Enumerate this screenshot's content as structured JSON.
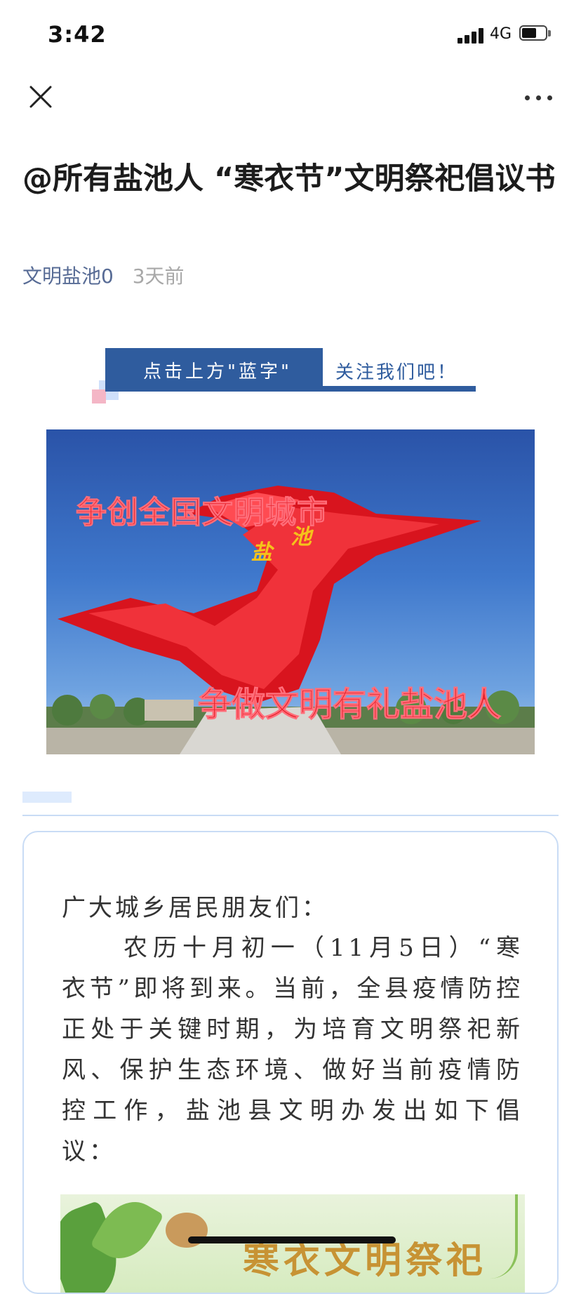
{
  "status_bar": {
    "time": "3:42",
    "network": "4G"
  },
  "nav": {
    "close_icon": "close-icon",
    "more_icon": "more-dots-icon"
  },
  "article": {
    "title": "@所有盐池人 “寒衣节”文明祭祀倡议书",
    "author": "文明盐池0",
    "date": "3天前"
  },
  "banner": {
    "dark_text": "点击上方\"蓝字\"",
    "light_text": "关注我们吧！"
  },
  "hero": {
    "top_text": "争创全国文明城市",
    "bottom_text": "争做文明有礼盐池人",
    "gold_text_1": "盐",
    "gold_text_2": "池"
  },
  "content": {
    "greeting": "广大城乡居民朋友们：",
    "paragraph": "农历十月初一（11月5日）“寒衣节”即将到来。当前，全县疫情防控正处于关键时期，为培育文明祭祀新风、保护生态环境、做好当前疫情防控工作，盐池县文明办发出如下倡议：",
    "inner_image_text": "寒衣文明祭祀"
  },
  "colors": {
    "accent_blue": "#2f5c9e",
    "author_link": "#576b95",
    "card_border": "#c9dcf5",
    "hero_red": "#e7232c"
  }
}
